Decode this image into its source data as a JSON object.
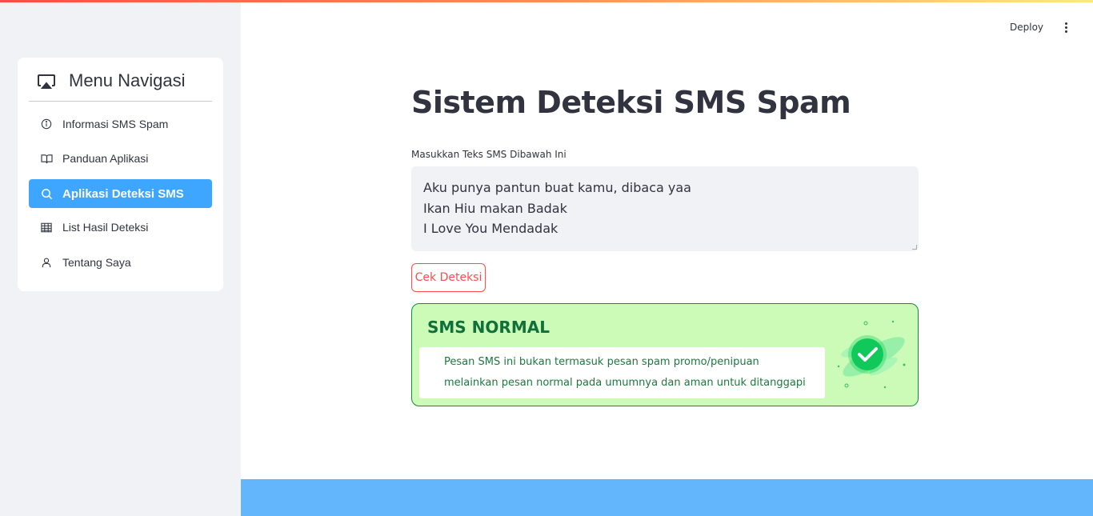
{
  "sidebar": {
    "title": "Menu Navigasi",
    "title_icon": "airplay-icon",
    "items": [
      {
        "label": "Informasi SMS Spam",
        "icon": "info-circle-icon",
        "active": false
      },
      {
        "label": "Panduan Aplikasi",
        "icon": "book-icon",
        "active": false
      },
      {
        "label": "Aplikasi Deteksi SMS",
        "icon": "search-icon",
        "active": true
      },
      {
        "label": "List Hasil Deteksi",
        "icon": "table-icon",
        "active": false
      },
      {
        "label": "Tentang Saya",
        "icon": "person-icon",
        "active": false
      }
    ]
  },
  "header": {
    "deploy_label": "Deploy",
    "menu_icon": "kebab-menu-icon"
  },
  "main": {
    "title": "Sistem Deteksi SMS Spam",
    "input_label": "Masukkan Teks SMS Dibawah Ini",
    "input_value": "Aku punya pantun buat kamu, dibaca yaa\nIkan Hiu makan Badak\nI Love You Mendadak",
    "button_label": "Cek Deteksi",
    "result": {
      "title": "SMS NORMAL",
      "message_line1": "Pesan SMS ini bukan termasuk pesan spam promo/penipuan",
      "message_line2": "melainkan pesan normal pada umumnya dan aman untuk ditanggapi",
      "icon": "check-circle-icon"
    }
  },
  "colors": {
    "accent": "#3ea6ff",
    "button_border": "#ff4b4b",
    "result_bg": "#ccfbb8",
    "result_text": "#10703a",
    "bottom_band": "#63b5fc"
  }
}
